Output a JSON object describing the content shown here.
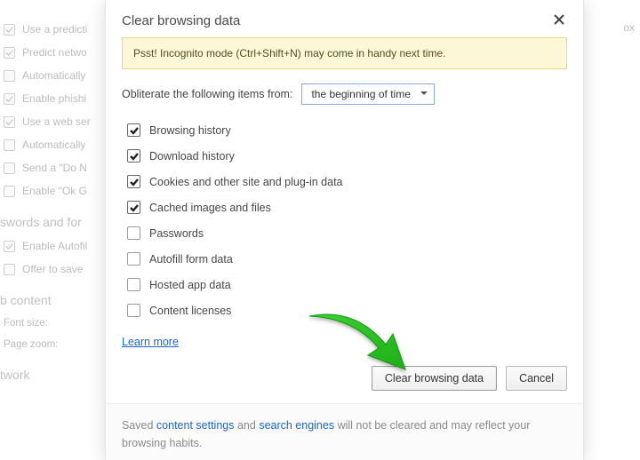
{
  "background": {
    "rows": [
      {
        "checked": true,
        "label": "Use a predicti"
      },
      {
        "checked": true,
        "label": "Predict netwo"
      },
      {
        "checked": false,
        "label": "Automatically"
      },
      {
        "checked": true,
        "label": "Enable phishi"
      },
      {
        "checked": true,
        "label": "Use a web ser"
      },
      {
        "checked": false,
        "label": "Automatically"
      },
      {
        "checked": false,
        "label": "Send a \"Do N"
      },
      {
        "checked": false,
        "label": "Enable \"Ok G"
      }
    ],
    "section_pw": "swords and for",
    "rows2": [
      {
        "checked": true,
        "label": "Enable Autofil"
      },
      {
        "checked": false,
        "label": "Offer to save"
      }
    ],
    "section_web": "b content",
    "font_label": "Font size:",
    "zoom_label": "Page zoom:",
    "section_net": "twork",
    "right_tail": "ox"
  },
  "modal": {
    "title": "Clear browsing data",
    "tip": "Psst! Incognito mode (Ctrl+Shift+N) may come in handy next time.",
    "obliterate_label": "Obliterate the following items from:",
    "range_selected": "the beginning of time",
    "options": [
      {
        "checked": true,
        "label": "Browsing history"
      },
      {
        "checked": true,
        "label": "Download history"
      },
      {
        "checked": true,
        "label": "Cookies and other site and plug-in data"
      },
      {
        "checked": true,
        "label": "Cached images and files"
      },
      {
        "checked": false,
        "label": "Passwords"
      },
      {
        "checked": false,
        "label": "Autofill form data"
      },
      {
        "checked": false,
        "label": "Hosted app data"
      },
      {
        "checked": false,
        "label": "Content licenses"
      }
    ],
    "learn_more": "Learn more",
    "primary_btn": "Clear browsing data",
    "cancel_btn": "Cancel",
    "footer": {
      "pre": "Saved ",
      "link1": "content settings",
      "mid": " and ",
      "link2": "search engines",
      "post": " will not be cleared and may reflect your browsing habits."
    }
  }
}
